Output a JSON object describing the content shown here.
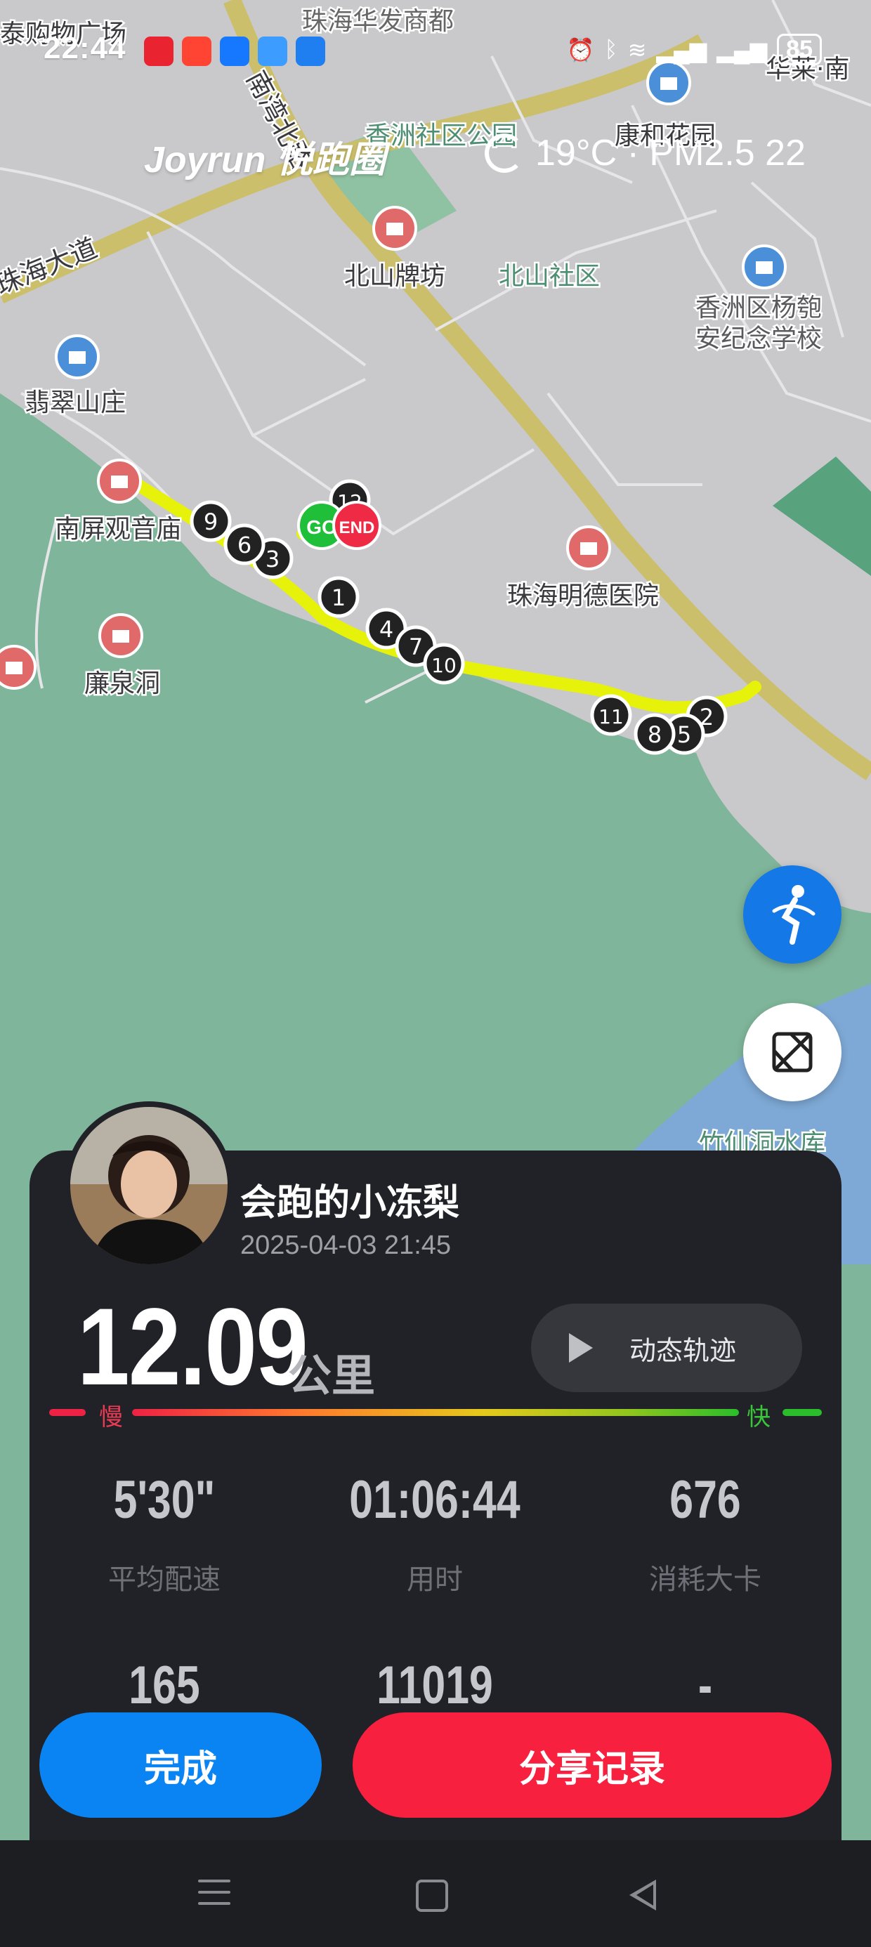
{
  "status_bar": {
    "time": "22:44",
    "battery": "85",
    "app_icon_colors": [
      "#e9232f",
      "#ff4433",
      "#1677ff",
      "#3d9cff",
      "#1f7ef0"
    ]
  },
  "brand": {
    "logo": "Joyrun 悦跑圈"
  },
  "weather": {
    "text": "19°C · PM2.5 22"
  },
  "map": {
    "place_labels": [
      "珠海华发商都",
      "香洲社区公园",
      "康和花园",
      "北山牌坊",
      "北山社区",
      "香洲区杨匏安纪念学校",
      "翡翠山庄",
      "南屏观音庙",
      "珠海明德医院",
      "廉泉洞",
      "珠海大道",
      "南湾北路",
      "竹仙洞水库",
      "华莱·南",
      "泰购物广场"
    ],
    "route_markers": [
      "1",
      "2",
      "3",
      "4",
      "5",
      "6",
      "7",
      "8",
      "9",
      "10",
      "11",
      "12"
    ],
    "start_label": "GO",
    "end_label": "END"
  },
  "runner": {
    "name": "会跑的小冻梨",
    "datetime": "2025-04-03 21:45"
  },
  "summary": {
    "distance": "12.09",
    "distance_unit": "公里",
    "replay_label": "动态轨迹",
    "pace_slow_label": "慢",
    "pace_fast_label": "快"
  },
  "stats": [
    {
      "value": "5'30\"",
      "label": "平均配速"
    },
    {
      "value": "01:06:44",
      "label": "用时"
    },
    {
      "value": "676",
      "label": "消耗大卡"
    },
    {
      "value": "165",
      "label": ""
    },
    {
      "value": "11019",
      "label": ""
    },
    {
      "value": "-",
      "label": ""
    }
  ],
  "actions": {
    "done": "完成",
    "share": "分享记录"
  },
  "colors": {
    "route": "#e6f20a",
    "done_button": "#0a84f2",
    "share_button": "#f8203f",
    "card_bg": "#212227",
    "start_marker": "#1fbf3a",
    "end_marker": "#ef2a44"
  }
}
